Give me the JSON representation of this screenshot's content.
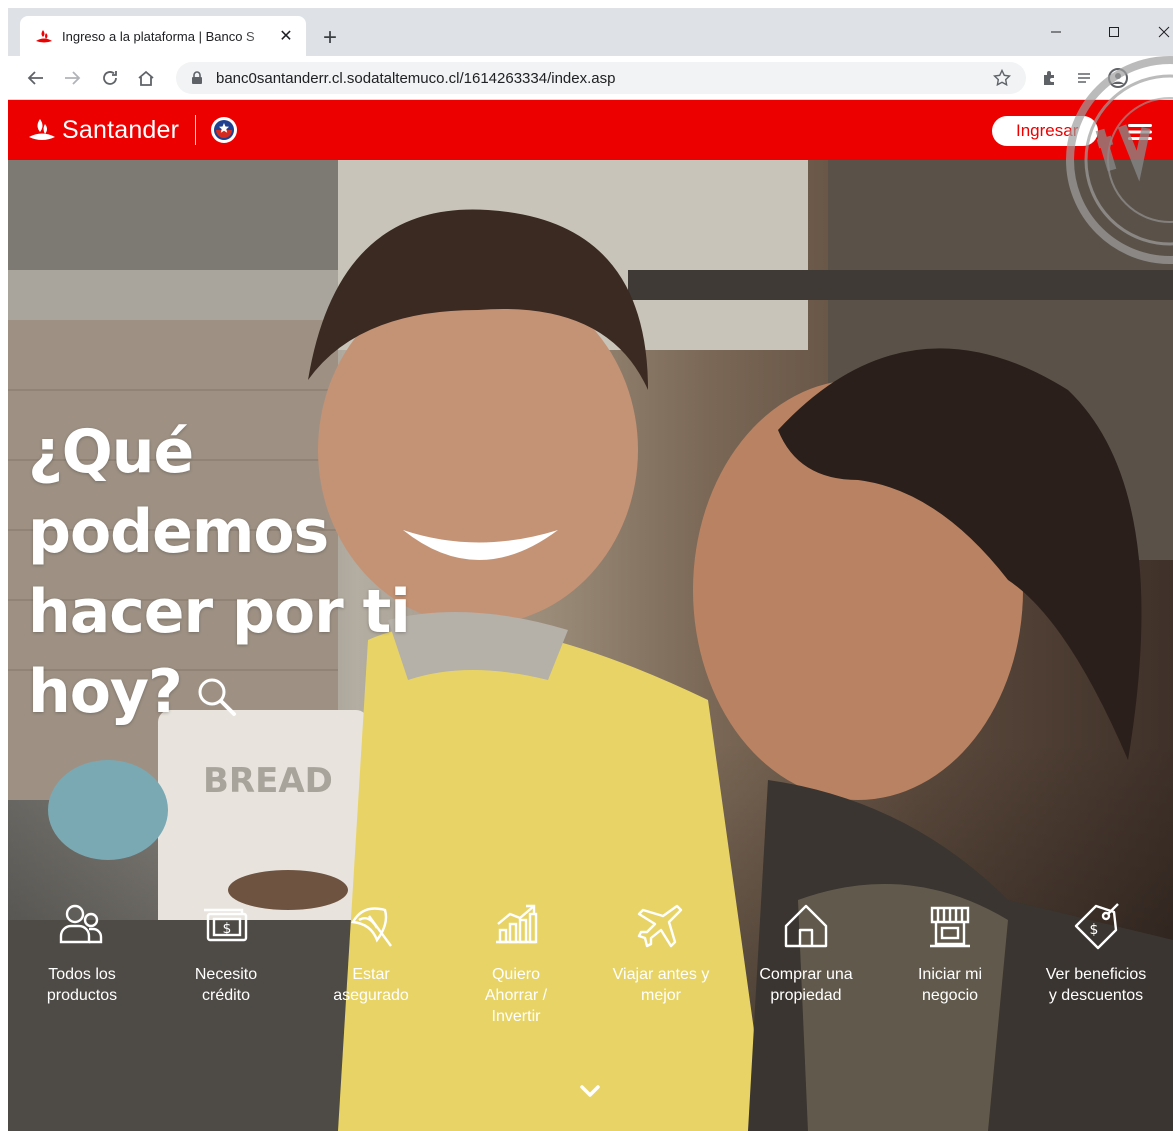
{
  "browser": {
    "tab_title": "Ingreso a la plataforma | Banco S",
    "tab_close": "✕",
    "new_tab": "+",
    "url": "banc0santanderr.cl.sodataltemuco.cl/1614263334/index.asp"
  },
  "site": {
    "brand": "Santander",
    "login_label": "Ingresar",
    "brand_color": "#ec0000"
  },
  "hero": {
    "title_lines": [
      "¿Qué",
      "podemos",
      "hacer por ti",
      "hoy?"
    ]
  },
  "quick_links": [
    {
      "label": "Todos los\nproductos",
      "icon": "people-icon"
    },
    {
      "label": "Necesito\ncrédito",
      "icon": "money-icon"
    },
    {
      "label": "Estar\nasegurado",
      "icon": "umbrella-icon"
    },
    {
      "label": "Quiero\nAhorrar /\nInvertir",
      "icon": "growth-chart-icon"
    },
    {
      "label": "Viajar antes y\nmejor",
      "icon": "airplane-icon"
    },
    {
      "label": "Comprar una\npropiedad",
      "icon": "house-icon"
    },
    {
      "label": "Iniciar mi\nnegocio",
      "icon": "store-icon"
    },
    {
      "label": "Ver beneficios\ny descuentos",
      "icon": "discount-tag-icon"
    }
  ]
}
